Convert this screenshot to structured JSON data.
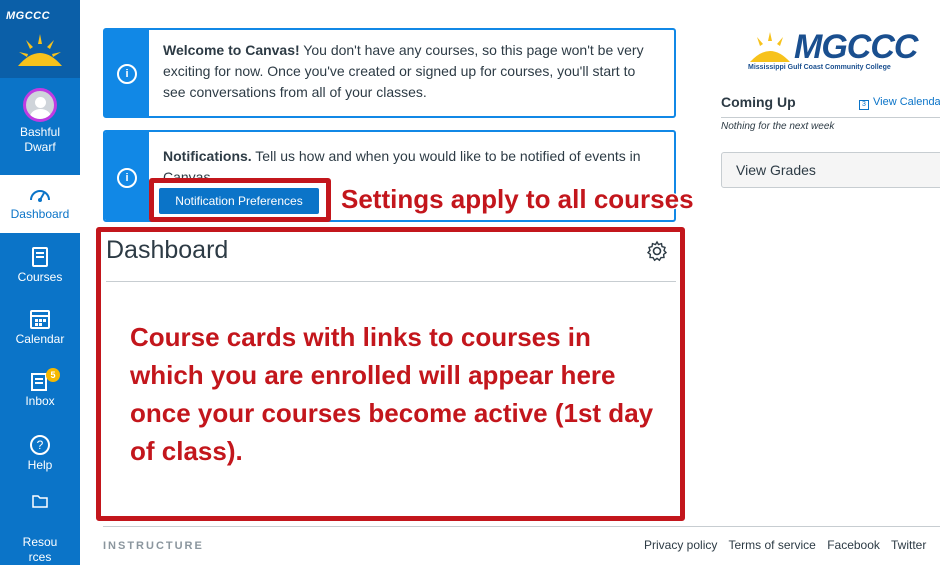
{
  "sidebar": {
    "logo_text": "MGCCC",
    "account": {
      "line1": "Bashful",
      "line2": "Dwarf"
    },
    "items": [
      {
        "label": "Dashboard",
        "icon": "dashboard-icon"
      },
      {
        "label": "Courses",
        "icon": "book-icon"
      },
      {
        "label": "Calendar",
        "icon": "calendar-icon"
      },
      {
        "label": "Inbox",
        "icon": "inbox-icon",
        "badge": "5"
      },
      {
        "label": "Help",
        "icon": "help-icon"
      },
      {
        "label": "Resou rces",
        "icon": "folder-icon",
        "line1": "Resou",
        "line2": "rces"
      }
    ]
  },
  "alerts": {
    "welcome": {
      "title": "Welcome to Canvas!",
      "body": " You don't have any courses, so this page won't be very exciting for now. Once you've created or signed up for courses, you'll start to see conversations from all of your classes."
    },
    "notifications": {
      "title": "Notifications.",
      "body": " Tell us how and when you would like to be notified of events in Canvas.",
      "button": "Notification Preferences"
    }
  },
  "annotations": {
    "settings": "Settings apply to all courses",
    "cards": "Course cards with links to courses in which you are enrolled will appear here once your courses become active (1st day of class)."
  },
  "dashboard": {
    "title": "Dashboard"
  },
  "right": {
    "brand": "MGCCC",
    "brand_sub": "Mississippi Gulf Coast Community College",
    "coming_up": "Coming Up",
    "view_calendar": "View Calendar",
    "nothing": "Nothing for the next week",
    "view_grades": "View Grades"
  },
  "footer": {
    "brand": "INSTRUCTURE",
    "links": [
      "Privacy policy",
      "Terms of service",
      "Facebook",
      "Twitter"
    ]
  },
  "colors": {
    "sidebar": "#0b74c8",
    "alert": "#1188e6",
    "annotation": "#c3161c"
  }
}
